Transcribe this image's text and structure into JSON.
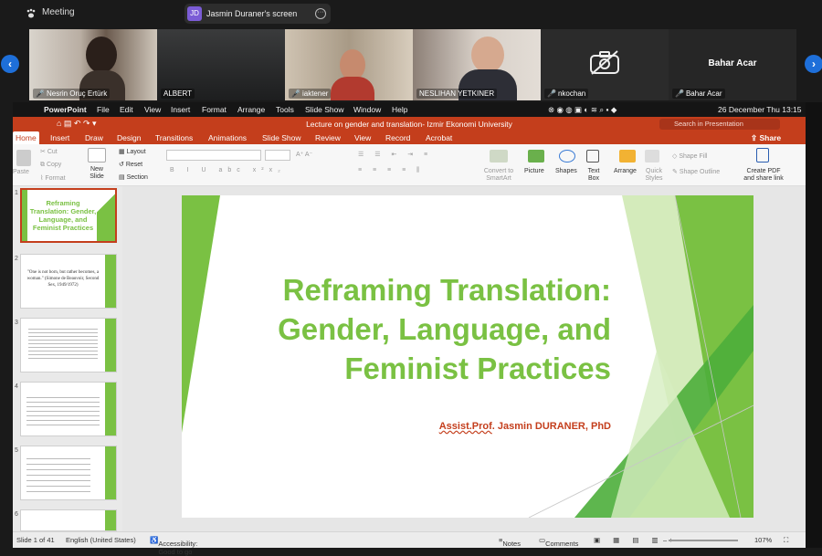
{
  "meeting": {
    "label": "Meeting",
    "share_initials": "JD",
    "share_text": "Jasmin Duraner's screen"
  },
  "participants": [
    {
      "name": "Nesrin Oruç Ertürk",
      "muted": true
    },
    {
      "name": "ALBERT",
      "muted": false
    },
    {
      "name": "iaktener",
      "muted": true
    },
    {
      "name": "NESLIHAN YETKINER",
      "muted": false
    },
    {
      "name": "nkochan",
      "muted": true
    },
    {
      "name": "Bahar Acar",
      "muted": true,
      "camera_off": true,
      "display_name": "Bahar Acar"
    }
  ],
  "macbar": {
    "app": "PowerPoint",
    "menus": [
      "File",
      "Edit",
      "View",
      "Insert",
      "Format",
      "Arrange",
      "Tools",
      "Slide Show",
      "Window",
      "Help"
    ],
    "datetime": "26 December Thu  13:15"
  },
  "ppt": {
    "title": "Lecture on gender and translation- Izmir Ekonomi University",
    "search_placeholder": "Search in Presentation",
    "share": "Share",
    "tabs": [
      "Home",
      "Insert",
      "Draw",
      "Design",
      "Transitions",
      "Animations",
      "Slide Show",
      "Review",
      "View",
      "Record",
      "Acrobat"
    ],
    "ribbon": {
      "paste": "Paste",
      "cut": "Cut",
      "copy": "Copy",
      "format": "Format",
      "new_slide": "New Slide",
      "layout": "Layout",
      "reset": "Reset",
      "section": "Section",
      "convert": "Convert to SmartArt",
      "picture": "Picture",
      "shapes": "Shapes",
      "text_box": "Text Box",
      "arrange": "Arrange",
      "quick_styles": "Quick Styles",
      "shape_fill": "Shape Fill",
      "shape_outline": "Shape Outline",
      "create_pdf": "Create PDF and share link"
    },
    "thumbnails": [
      {
        "num": "1",
        "text": "Reframing Translation: Gender, Language, and Feminist Practices"
      },
      {
        "num": "2",
        "text": "\"One is not born, but rather becomes, a woman.\" (Simone de Beauvoir, Second Sex, 1949/1972)"
      },
      {
        "num": "3",
        "text": ""
      },
      {
        "num": "4",
        "text": ""
      },
      {
        "num": "5",
        "text": ""
      },
      {
        "num": "6",
        "text": ""
      }
    ],
    "slide": {
      "title_lines": [
        "Reframing Translation:",
        "Gender, Language, and",
        "Feminist Practices"
      ],
      "author_prefix": "Assist.Prof",
      "author_rest": ". Jasmin DURANER, PhD"
    },
    "status": {
      "slide": "Slide 1 of 41",
      "lang": "English (United States)",
      "accessibility": "Accessibility: Good to go",
      "notes": "Notes",
      "comments": "Comments",
      "zoom": "107%"
    }
  },
  "colors": {
    "ppt_red": "#c43e1c",
    "green": "#7ac143"
  }
}
